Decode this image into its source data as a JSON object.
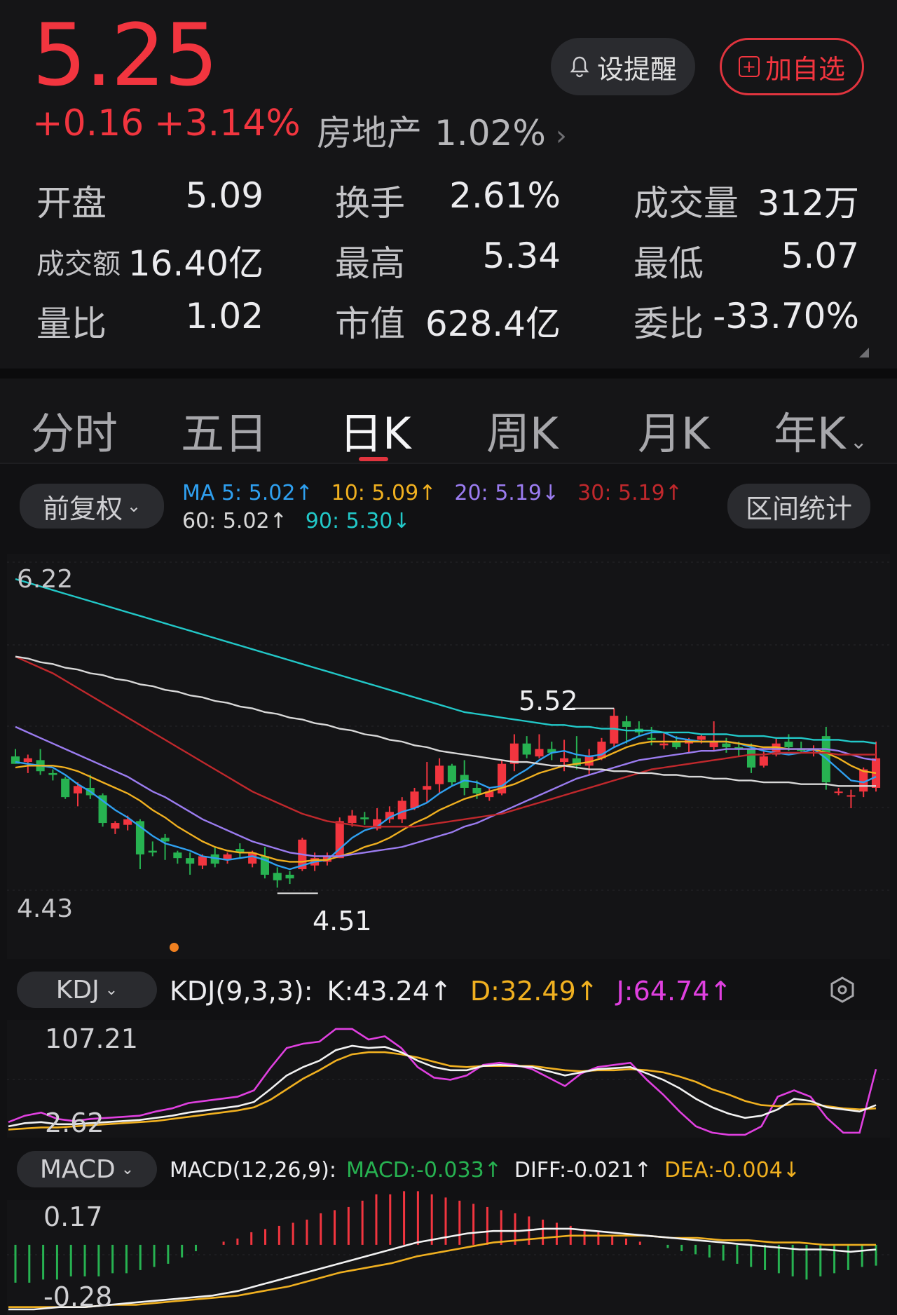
{
  "quote": {
    "price": "5.25",
    "change": "+0.16",
    "change_pct": "+3.14%",
    "sector_name": "房地产",
    "sector_pct": "1.02%",
    "remind_label": "设提醒",
    "fav_label": "加自选"
  },
  "stats": [
    {
      "label": "开盘",
      "value": "5.09",
      "color": "normal"
    },
    {
      "label": "换手",
      "value": "2.61%",
      "color": "normal"
    },
    {
      "label": "成交量",
      "value": "312万",
      "color": "normal"
    },
    {
      "label": "成交额",
      "value": "16.40亿",
      "color": "normal"
    },
    {
      "label": "最高",
      "value": "5.34",
      "color": "red"
    },
    {
      "label": "最低",
      "value": "5.07",
      "color": "green"
    },
    {
      "label": "量比",
      "value": "1.02",
      "color": "normal"
    },
    {
      "label": "市值",
      "value": "628.4亿",
      "color": "normal"
    },
    {
      "label": "委比",
      "value": "-33.70%",
      "color": "green"
    }
  ],
  "tabs": [
    "分时",
    "五日",
    "日K",
    "周K",
    "月K",
    "年K"
  ],
  "active_tab": "日K",
  "adjust_label": "前复权",
  "range_stat_label": "区间统计",
  "ma_legend": [
    {
      "text": "MA 5: 5.02↑",
      "color": "#2fa0f0"
    },
    {
      "text": "10: 5.09↑",
      "color": "#f0b020"
    },
    {
      "text": "20: 5.19↓",
      "color": "#9b7cf0"
    },
    {
      "text": "30: 5.19↑",
      "color": "#c0282c"
    },
    {
      "text": "60: 5.02↑",
      "color": "#d8d8d8"
    },
    {
      "text": "90: 5.30↓",
      "color": "#22c8c8"
    }
  ],
  "kline": {
    "y_top": "6.22",
    "y_bottom": "4.43",
    "high_label": "5.52",
    "low_label": "4.51"
  },
  "kdj": {
    "indicator": "KDJ",
    "params": "KDJ(9,3,3):",
    "k": "K:43.24↑",
    "d": "D:32.49↑",
    "j": "J:64.74↑",
    "y_top": "107.21",
    "y_bottom": "2.62"
  },
  "macd": {
    "indicator": "MACD",
    "params": "MACD(12,26,9):",
    "macd": "MACD:-0.033↑",
    "diff": "DIFF:-0.021↑",
    "dea": "DEA:-0.004↓",
    "y_top": "0.17",
    "y_bottom": "-0.28"
  },
  "colors": {
    "up": "#f2353f",
    "down": "#27b251",
    "accent": "#e0343e"
  },
  "chart_data": {
    "type": "candlestick",
    "y_range": [
      4.43,
      6.22
    ],
    "candles": [
      {
        "o": 5.26,
        "h": 5.3,
        "l": 5.22,
        "c": 5.22
      },
      {
        "o": 5.23,
        "h": 5.27,
        "l": 5.17,
        "c": 5.25
      },
      {
        "o": 5.24,
        "h": 5.3,
        "l": 5.16,
        "c": 5.18
      },
      {
        "o": 5.17,
        "h": 5.19,
        "l": 5.13,
        "c": 5.16
      },
      {
        "o": 5.14,
        "h": 5.15,
        "l": 5.03,
        "c": 5.04
      },
      {
        "o": 5.06,
        "h": 5.12,
        "l": 4.99,
        "c": 5.1
      },
      {
        "o": 5.09,
        "h": 5.16,
        "l": 5.03,
        "c": 5.05
      },
      {
        "o": 5.05,
        "h": 5.06,
        "l": 4.88,
        "c": 4.9
      },
      {
        "o": 4.87,
        "h": 4.91,
        "l": 4.84,
        "c": 4.9
      },
      {
        "o": 4.89,
        "h": 4.94,
        "l": 4.86,
        "c": 4.92
      },
      {
        "o": 4.91,
        "h": 4.92,
        "l": 4.65,
        "c": 4.73
      },
      {
        "o": 4.75,
        "h": 4.8,
        "l": 4.72,
        "c": 4.74
      },
      {
        "o": 4.82,
        "h": 4.84,
        "l": 4.7,
        "c": 4.8
      },
      {
        "o": 4.74,
        "h": 4.75,
        "l": 4.68,
        "c": 4.71
      },
      {
        "o": 4.71,
        "h": 4.74,
        "l": 4.62,
        "c": 4.68
      },
      {
        "o": 4.67,
        "h": 4.73,
        "l": 4.65,
        "c": 4.72
      },
      {
        "o": 4.73,
        "h": 4.77,
        "l": 4.66,
        "c": 4.68
      },
      {
        "o": 4.7,
        "h": 4.74,
        "l": 4.68,
        "c": 4.73
      },
      {
        "o": 4.76,
        "h": 4.79,
        "l": 4.71,
        "c": 4.74
      },
      {
        "o": 4.68,
        "h": 4.75,
        "l": 4.66,
        "c": 4.74
      },
      {
        "o": 4.72,
        "h": 4.77,
        "l": 4.6,
        "c": 4.62
      },
      {
        "o": 4.63,
        "h": 4.66,
        "l": 4.55,
        "c": 4.59
      },
      {
        "o": 4.62,
        "h": 4.64,
        "l": 4.57,
        "c": 4.6
      },
      {
        "o": 4.65,
        "h": 4.82,
        "l": 4.64,
        "c": 4.81
      },
      {
        "o": 4.67,
        "h": 4.74,
        "l": 4.64,
        "c": 4.71
      },
      {
        "o": 4.69,
        "h": 4.74,
        "l": 4.67,
        "c": 4.72
      },
      {
        "o": 4.71,
        "h": 4.93,
        "l": 4.71,
        "c": 4.91
      },
      {
        "o": 4.9,
        "h": 4.97,
        "l": 4.88,
        "c": 4.94
      },
      {
        "o": 4.93,
        "h": 4.96,
        "l": 4.89,
        "c": 4.92
      },
      {
        "o": 4.87,
        "h": 4.98,
        "l": 4.86,
        "c": 4.92
      },
      {
        "o": 4.92,
        "h": 4.99,
        "l": 4.9,
        "c": 4.96
      },
      {
        "o": 4.92,
        "h": 5.04,
        "l": 4.9,
        "c": 5.02
      },
      {
        "o": 4.98,
        "h": 5.09,
        "l": 4.97,
        "c": 5.07
      },
      {
        "o": 5.08,
        "h": 5.23,
        "l": 5.01,
        "c": 5.1
      },
      {
        "o": 5.11,
        "h": 5.25,
        "l": 5.06,
        "c": 5.21
      },
      {
        "o": 5.21,
        "h": 5.22,
        "l": 5.1,
        "c": 5.12
      },
      {
        "o": 5.16,
        "h": 5.24,
        "l": 5.05,
        "c": 5.09
      },
      {
        "o": 5.09,
        "h": 5.13,
        "l": 5.03,
        "c": 5.06
      },
      {
        "o": 5.04,
        "h": 5.09,
        "l": 5.02,
        "c": 5.07
      },
      {
        "o": 5.06,
        "h": 5.24,
        "l": 5.05,
        "c": 5.22
      },
      {
        "o": 5.22,
        "h": 5.38,
        "l": 5.18,
        "c": 5.33
      },
      {
        "o": 5.33,
        "h": 5.37,
        "l": 5.25,
        "c": 5.27
      },
      {
        "o": 5.26,
        "h": 5.38,
        "l": 5.25,
        "c": 5.3
      },
      {
        "o": 5.3,
        "h": 5.34,
        "l": 5.24,
        "c": 5.28
      },
      {
        "o": 5.23,
        "h": 5.35,
        "l": 5.18,
        "c": 5.25
      },
      {
        "o": 5.25,
        "h": 5.37,
        "l": 5.19,
        "c": 5.21
      },
      {
        "o": 5.21,
        "h": 5.3,
        "l": 5.16,
        "c": 5.26
      },
      {
        "o": 5.25,
        "h": 5.36,
        "l": 5.24,
        "c": 5.34
      },
      {
        "o": 5.33,
        "h": 5.52,
        "l": 5.31,
        "c": 5.48
      },
      {
        "o": 5.45,
        "h": 5.48,
        "l": 5.33,
        "c": 5.42
      },
      {
        "o": 5.41,
        "h": 5.45,
        "l": 5.37,
        "c": 5.39
      },
      {
        "o": 5.36,
        "h": 5.42,
        "l": 5.32,
        "c": 5.35
      },
      {
        "o": 5.32,
        "h": 5.39,
        "l": 5.3,
        "c": 5.33
      },
      {
        "o": 5.34,
        "h": 5.37,
        "l": 5.3,
        "c": 5.31
      },
      {
        "o": 5.33,
        "h": 5.36,
        "l": 5.28,
        "c": 5.35
      },
      {
        "o": 5.35,
        "h": 5.38,
        "l": 5.33,
        "c": 5.37
      },
      {
        "o": 5.31,
        "h": 5.45,
        "l": 5.29,
        "c": 5.34
      },
      {
        "o": 5.33,
        "h": 5.36,
        "l": 5.28,
        "c": 5.31
      },
      {
        "o": 5.31,
        "h": 5.34,
        "l": 5.26,
        "c": 5.3
      },
      {
        "o": 5.3,
        "h": 5.33,
        "l": 5.17,
        "c": 5.2
      },
      {
        "o": 5.21,
        "h": 5.29,
        "l": 5.2,
        "c": 5.26
      },
      {
        "o": 5.27,
        "h": 5.36,
        "l": 5.26,
        "c": 5.33
      },
      {
        "o": 5.34,
        "h": 5.38,
        "l": 5.29,
        "c": 5.31
      },
      {
        "o": 5.3,
        "h": 5.34,
        "l": 5.28,
        "c": 5.29
      },
      {
        "o": 5.29,
        "h": 5.32,
        "l": 5.26,
        "c": 5.3
      },
      {
        "o": 5.37,
        "h": 5.42,
        "l": 5.08,
        "c": 5.12
      },
      {
        "o": 5.07,
        "h": 5.09,
        "l": 5.05,
        "c": 5.07
      },
      {
        "o": 5.05,
        "h": 5.08,
        "l": 4.98,
        "c": 5.05
      },
      {
        "o": 5.07,
        "h": 5.2,
        "l": 5.04,
        "c": 5.19
      },
      {
        "o": 5.09,
        "h": 5.34,
        "l": 5.07,
        "c": 5.25
      }
    ],
    "ma": {
      "MA5": [
        5.23,
        5.22,
        5.21,
        5.2,
        5.16,
        5.11,
        5.07,
        5.02,
        4.97,
        4.93,
        4.88,
        4.83,
        4.79,
        4.77,
        4.75,
        4.72,
        4.71,
        4.7,
        4.71,
        4.72,
        4.7,
        4.67,
        4.65,
        4.67,
        4.69,
        4.7,
        4.76,
        4.82,
        4.86,
        4.88,
        4.93,
        4.96,
        4.98,
        5.01,
        5.06,
        5.1,
        5.13,
        5.12,
        5.09,
        5.1,
        5.15,
        5.19,
        5.24,
        5.28,
        5.29,
        5.27,
        5.26,
        5.27,
        5.31,
        5.34,
        5.37,
        5.39,
        5.39,
        5.36,
        5.35,
        5.34,
        5.34,
        5.34,
        5.33,
        5.31,
        5.29,
        5.28,
        5.27,
        5.28,
        5.3,
        5.25,
        5.19,
        5.13,
        5.12,
        5.15
      ],
      "MA10": [
        5.2,
        5.21,
        5.21,
        5.21,
        5.2,
        5.18,
        5.15,
        5.12,
        5.09,
        5.06,
        5.02,
        4.97,
        4.93,
        4.88,
        4.84,
        4.8,
        4.77,
        4.75,
        4.74,
        4.74,
        4.72,
        4.7,
        4.69,
        4.69,
        4.7,
        4.7,
        4.72,
        4.74,
        4.77,
        4.79,
        4.82,
        4.86,
        4.9,
        4.93,
        4.97,
        5.0,
        5.03,
        5.05,
        5.07,
        5.09,
        5.11,
        5.14,
        5.17,
        5.19,
        5.21,
        5.22,
        5.23,
        5.25,
        5.28,
        5.31,
        5.33,
        5.34,
        5.34,
        5.34,
        5.34,
        5.34,
        5.34,
        5.34,
        5.33,
        5.32,
        5.31,
        5.31,
        5.3,
        5.3,
        5.3,
        5.28,
        5.25,
        5.21,
        5.18,
        5.17
      ],
      "MA20": [
        5.42,
        5.39,
        5.36,
        5.33,
        5.3,
        5.27,
        5.24,
        5.21,
        5.18,
        5.15,
        5.11,
        5.07,
        5.04,
        5.0,
        4.96,
        4.92,
        4.89,
        4.86,
        4.83,
        4.8,
        4.78,
        4.76,
        4.74,
        4.73,
        4.72,
        4.72,
        4.72,
        4.73,
        4.74,
        4.75,
        4.76,
        4.77,
        4.79,
        4.81,
        4.83,
        4.85,
        4.88,
        4.9,
        4.93,
        4.96,
        4.99,
        5.02,
        5.05,
        5.08,
        5.11,
        5.14,
        5.16,
        5.18,
        5.2,
        5.22,
        5.24,
        5.25,
        5.26,
        5.27,
        5.28,
        5.29,
        5.29,
        5.3,
        5.3,
        5.3,
        5.3,
        5.3,
        5.3,
        5.3,
        5.3,
        5.3,
        5.29,
        5.27,
        5.25,
        5.24
      ],
      "MA30": [
        5.8,
        5.77,
        5.74,
        5.71,
        5.67,
        5.63,
        5.59,
        5.55,
        5.51,
        5.47,
        5.43,
        5.39,
        5.35,
        5.31,
        5.27,
        5.23,
        5.19,
        5.15,
        5.11,
        5.07,
        5.04,
        5.01,
        4.98,
        4.95,
        4.93,
        4.91,
        4.9,
        4.89,
        4.88,
        4.88,
        4.88,
        4.88,
        4.88,
        4.89,
        4.9,
        4.91,
        4.92,
        4.93,
        4.94,
        4.95,
        4.97,
        4.99,
        5.01,
        5.03,
        5.05,
        5.07,
        5.09,
        5.11,
        5.13,
        5.15,
        5.17,
        5.19,
        5.2,
        5.21,
        5.22,
        5.23,
        5.24,
        5.25,
        5.26,
        5.27,
        5.27,
        5.28,
        5.28,
        5.28,
        5.28,
        5.28,
        5.27,
        5.27,
        5.27,
        5.27
      ],
      "MA60": [
        5.8,
        5.79,
        5.77,
        5.76,
        5.74,
        5.73,
        5.71,
        5.7,
        5.68,
        5.67,
        5.65,
        5.64,
        5.62,
        5.61,
        5.59,
        5.58,
        5.56,
        5.55,
        5.53,
        5.52,
        5.5,
        5.49,
        5.47,
        5.46,
        5.44,
        5.43,
        5.41,
        5.4,
        5.38,
        5.37,
        5.35,
        5.34,
        5.32,
        5.31,
        5.29,
        5.28,
        5.27,
        5.26,
        5.25,
        5.24,
        5.23,
        5.23,
        5.22,
        5.21,
        5.21,
        5.2,
        5.19,
        5.19,
        5.18,
        5.18,
        5.17,
        5.17,
        5.16,
        5.16,
        5.15,
        5.15,
        5.14,
        5.14,
        5.13,
        5.13,
        5.12,
        5.12,
        5.12,
        5.11,
        5.11,
        5.11,
        5.1,
        5.1,
        5.1,
        5.1
      ],
      "MA90": [
        6.22,
        6.2,
        6.18,
        6.16,
        6.14,
        6.12,
        6.1,
        6.08,
        6.06,
        6.04,
        6.02,
        6.0,
        5.98,
        5.96,
        5.94,
        5.92,
        5.9,
        5.88,
        5.86,
        5.84,
        5.82,
        5.8,
        5.78,
        5.76,
        5.74,
        5.72,
        5.7,
        5.68,
        5.66,
        5.64,
        5.62,
        5.6,
        5.58,
        5.56,
        5.54,
        5.52,
        5.5,
        5.49,
        5.48,
        5.47,
        5.46,
        5.45,
        5.44,
        5.43,
        5.43,
        5.42,
        5.42,
        5.41,
        5.41,
        5.4,
        5.4,
        5.4,
        5.39,
        5.39,
        5.39,
        5.38,
        5.38,
        5.38,
        5.37,
        5.37,
        5.37,
        5.36,
        5.36,
        5.36,
        5.35,
        5.35,
        5.35,
        5.34,
        5.34,
        5.33
      ]
    },
    "kdj_range": [
      2.62,
      107.21
    ],
    "K": [
      10,
      13,
      14,
      12,
      12,
      13,
      14,
      15,
      16,
      18,
      20,
      23,
      25,
      27,
      29,
      33,
      45,
      58,
      66,
      72,
      82,
      86,
      84,
      85,
      80,
      72,
      66,
      63,
      63,
      67,
      68,
      67,
      66,
      62,
      58,
      61,
      64,
      65,
      66,
      60,
      54,
      46,
      36,
      28,
      22,
      18,
      20,
      26,
      36,
      34,
      28,
      26,
      24,
      30
    ],
    "D": [
      7,
      8,
      9,
      9,
      10,
      11,
      12,
      13,
      14,
      15,
      17,
      19,
      21,
      23,
      25,
      28,
      35,
      45,
      55,
      63,
      72,
      78,
      80,
      80,
      78,
      75,
      71,
      67,
      66,
      67,
      67,
      67,
      67,
      65,
      63,
      62,
      63,
      63,
      64,
      63,
      61,
      57,
      52,
      45,
      40,
      34,
      30,
      29,
      31,
      31,
      29,
      27,
      26,
      27
    ],
    "J": [
      14,
      20,
      23,
      17,
      15,
      17,
      18,
      19,
      20,
      24,
      27,
      32,
      34,
      36,
      38,
      44,
      65,
      84,
      88,
      90,
      102,
      102,
      92,
      95,
      84,
      66,
      56,
      54,
      58,
      68,
      70,
      68,
      64,
      56,
      48,
      60,
      66,
      68,
      70,
      54,
      40,
      24,
      10,
      4,
      2,
      2,
      10,
      38,
      44,
      38,
      18,
      4,
      4,
      64
    ],
    "macd_range": [
      -0.28,
      0.17
    ],
    "DIFF": [
      -0.28,
      -0.28,
      -0.27,
      -0.27,
      -0.26,
      -0.25,
      -0.24,
      -0.23,
      -0.22,
      -0.2,
      -0.17,
      -0.14,
      -0.11,
      -0.08,
      -0.05,
      -0.02,
      0.01,
      0.03,
      0.05,
      0.06,
      0.06,
      0.07,
      0.07,
      0.06,
      0.05,
      0.04,
      0.03,
      0.02,
      0.01,
      0.0,
      -0.01,
      -0.02,
      -0.02,
      -0.03,
      -0.02
    ],
    "DEA": [
      -0.27,
      -0.27,
      -0.27,
      -0.27,
      -0.26,
      -0.26,
      -0.25,
      -0.24,
      -0.23,
      -0.22,
      -0.2,
      -0.18,
      -0.15,
      -0.12,
      -0.1,
      -0.08,
      -0.05,
      -0.03,
      -0.01,
      0.01,
      0.02,
      0.03,
      0.04,
      0.04,
      0.04,
      0.04,
      0.03,
      0.03,
      0.02,
      0.02,
      0.01,
      0.01,
      0.0,
      0.0,
      0.0
    ],
    "MACD_hist": [
      -0.06,
      -0.06,
      -0.055,
      -0.055,
      -0.05,
      -0.05,
      -0.05,
      -0.045,
      -0.045,
      -0.04,
      -0.035,
      -0.03,
      -0.02,
      -0.01,
      0.0,
      0.005,
      0.01,
      0.02,
      0.025,
      0.03,
      0.035,
      0.04,
      0.05,
      0.055,
      0.06,
      0.07,
      0.08,
      0.08,
      0.085,
      0.085,
      0.08,
      0.075,
      0.07,
      0.065,
      0.06,
      0.055,
      0.05,
      0.045,
      0.04,
      0.035,
      0.03,
      0.025,
      0.02,
      0.015,
      0.01,
      0.005,
      0.0,
      -0.005,
      -0.01,
      -0.015,
      -0.02,
      -0.025,
      -0.03,
      -0.035,
      -0.04,
      -0.045,
      -0.05,
      -0.055,
      -0.05,
      -0.045,
      -0.04,
      -0.035,
      -0.033
    ]
  }
}
